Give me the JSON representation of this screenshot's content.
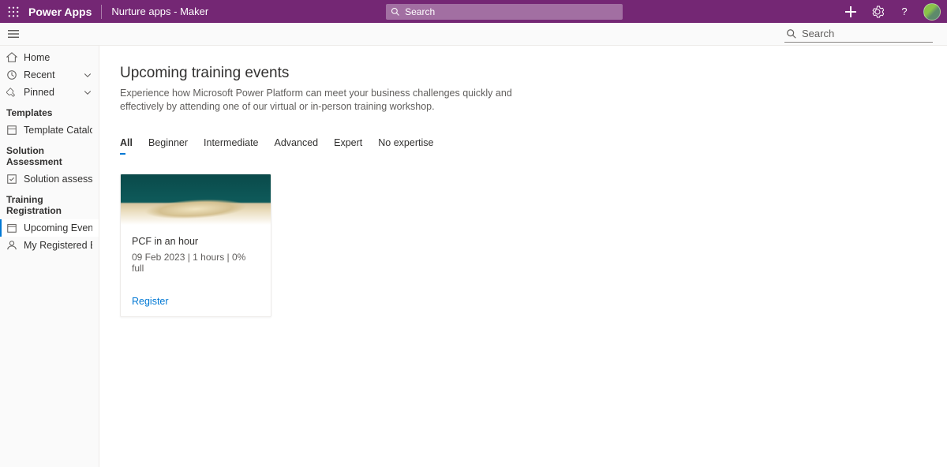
{
  "header": {
    "brand": "Power Apps",
    "app_name": "Nurture apps - Maker",
    "top_search_placeholder": "Search",
    "sub_search_placeholder": "Search"
  },
  "sidebar": {
    "items": [
      {
        "label": "Home"
      },
      {
        "label": "Recent"
      },
      {
        "label": "Pinned"
      }
    ],
    "sections": [
      {
        "title": "Templates",
        "items": [
          {
            "label": "Template Catalog"
          }
        ]
      },
      {
        "title": "Solution Assessment",
        "items": [
          {
            "label": "Solution assessment"
          }
        ]
      },
      {
        "title": "Training Registration",
        "items": [
          {
            "label": "Upcoming Events"
          },
          {
            "label": "My Registered Events"
          }
        ]
      }
    ]
  },
  "page": {
    "title": "Upcoming training events",
    "description": "Experience how Microsoft Power Platform can meet your business challenges quickly and effectively by attending one of our virtual or in-person training workshop."
  },
  "tabs": [
    {
      "label": "All",
      "active": true
    },
    {
      "label": "Beginner"
    },
    {
      "label": "Intermediate"
    },
    {
      "label": "Advanced"
    },
    {
      "label": "Expert"
    },
    {
      "label": "No expertise"
    }
  ],
  "event_card": {
    "title": "PCF in an hour",
    "meta": "09 Feb 2023 | 1 hours | 0% full",
    "register": "Register"
  }
}
